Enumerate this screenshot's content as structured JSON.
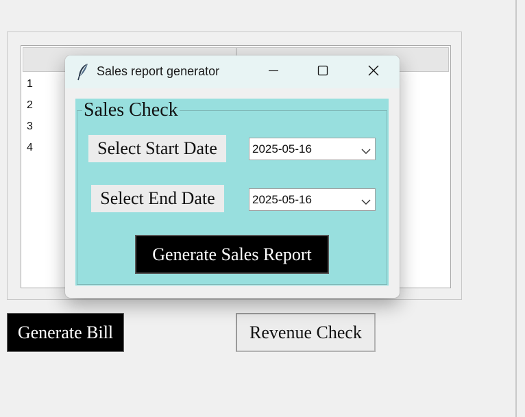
{
  "table": {
    "headers": [
      "",
      ""
    ],
    "rows": [
      "1",
      "2",
      "3",
      "4"
    ]
  },
  "buttons": {
    "generate_bill": "Generate Bill",
    "revenue_check": "Revenue Check"
  },
  "dialog": {
    "title": "Sales report generator",
    "app_icon": "feather-icon",
    "fieldset_label": "Sales Check",
    "start_label": "Select Start Date",
    "start_value": "2025-05-16",
    "end_label": "Select End Date",
    "end_value": "2025-05-16",
    "generate_button": "Generate Sales Report",
    "colors": {
      "panel_bg": "#98dfde",
      "titlebar_bg": "#e8f4f4",
      "button_bg": "#000000",
      "button_fg": "#ffffff"
    }
  }
}
